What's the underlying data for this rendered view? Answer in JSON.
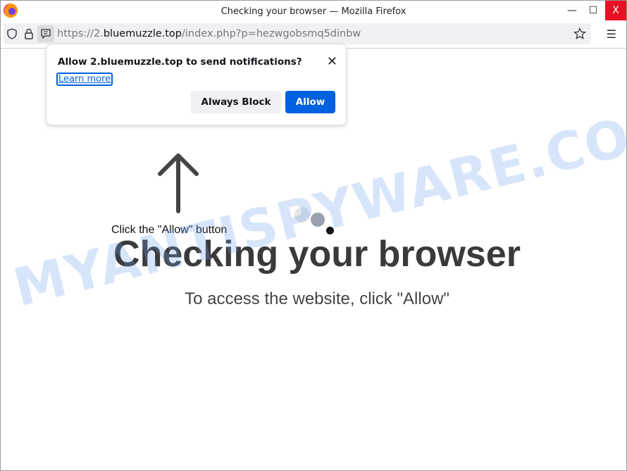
{
  "window": {
    "title": "Checking your browser — Mozilla Firefox",
    "minimize": "—",
    "maximize": "☐",
    "close": "X"
  },
  "urlbar": {
    "prefix": "https://2.",
    "domain": "bluemuzzle.top",
    "path": "/index.php?p=hezwgobsmq5dinbw"
  },
  "popup": {
    "title": "Allow 2.bluemuzzle.top to send notifications?",
    "learn_more": "Learn more",
    "block_label": "Always Block",
    "allow_label": "Allow"
  },
  "page": {
    "hint": "Click the \"Allow\" button",
    "heading": "Checking your browser",
    "subheading": "To access the website, click \"Allow\""
  },
  "watermark": "MYANTISPYWARE.COM",
  "colors": {
    "allow_button": "#0061e0",
    "dot1": "#e6e6e6",
    "dot2": "#9aa0ad",
    "dot3": "#111111"
  }
}
